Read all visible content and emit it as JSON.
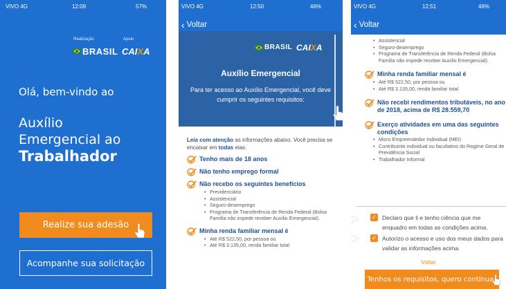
{
  "screen1": {
    "status": {
      "carrier": "VIVO  4G",
      "time": "12:09",
      "battery": "57%"
    },
    "sponsor_label_1": "Realização",
    "sponsor_label_2": "Apoio",
    "brasil_logo": "BRASIL",
    "caixa_logo": "CAIXA",
    "welcome": "Olá, bem-vindo ao",
    "title_line1": "Auxílio",
    "title_line2": "Emergencial ao",
    "title_line3": "Trabalhador",
    "primary_button": "Realize sua adesão",
    "secondary_button": "Acompanhe sua solicitação",
    "colors": {
      "background": "#1f6fd1",
      "accent": "#f28b1e"
    }
  },
  "screen2": {
    "status": {
      "carrier": "VIVO  4G",
      "time": "12:50",
      "battery": "46%"
    },
    "back_label": "Voltar",
    "title": "Auxílio Emergencial",
    "subtitle": "Para ter acesso ao Auxílio Emergencial, você deve cumprir os seguintes requisitos:",
    "lead_bold_1": "Leia com atenção",
    "lead_text_1": " as informações abaixo. Você precisa se encaixar em ",
    "lead_bold_2": "todas",
    "lead_text_2": " elas.",
    "requirements": [
      {
        "label": "Tenho mais de 18 anos"
      },
      {
        "label": "Não tenho emprego formal"
      },
      {
        "label": "Não recebo os seguintes benefícios"
      }
    ],
    "benefits": [
      "Previdenciário",
      "Assistencial",
      "Seguro-desemprego",
      "Programa de Transferência de Renda Federal (Bolsa Família não impede receber Auxílio Emergencial)."
    ],
    "income_label": "Minha renda familiar mensal é",
    "income_items": [
      "Até R$ 522,50, por pessoa ou",
      "Até R$ 3.135,00, renda familiar total"
    ]
  },
  "screen3": {
    "status": {
      "carrier": "VIVO  4G",
      "time": "12:51",
      "battery": "46%"
    },
    "back_label": "Voltar",
    "benefits_tail": [
      "Assistencial",
      "Seguro-desemprego",
      "Programa de Transferência de Renda Federal (Bolsa Família não impede receber Auxílio Emergencial)."
    ],
    "income_label": "Minha renda familiar mensal é",
    "income_items": [
      "Até R$ 522,50, por pessoa ou",
      "Até R$ 3.135,00, renda familiar total"
    ],
    "taxable_label": "Não recebi rendimentos tributáveis, no ano de 2018, acima de R$ 28.559,70",
    "activity_label": "Exerço atividades em uma das seguintes condições",
    "activity_items": [
      "Micro Empreendedor Individual (MEI)",
      "Contribuinte individual ou facultativo do Regime Geral de Previdência Social",
      "Trabalhador Informal"
    ],
    "consent_1": "Declaro que li e tenho ciência que me enquadro em todas as condições acima.",
    "consent_2": "Autorizo o acesso e uso dos meus dados para validar as informações acima.",
    "link_back": "Voltar",
    "submit_button": "Tenhos os requisitos, quero continuar"
  }
}
